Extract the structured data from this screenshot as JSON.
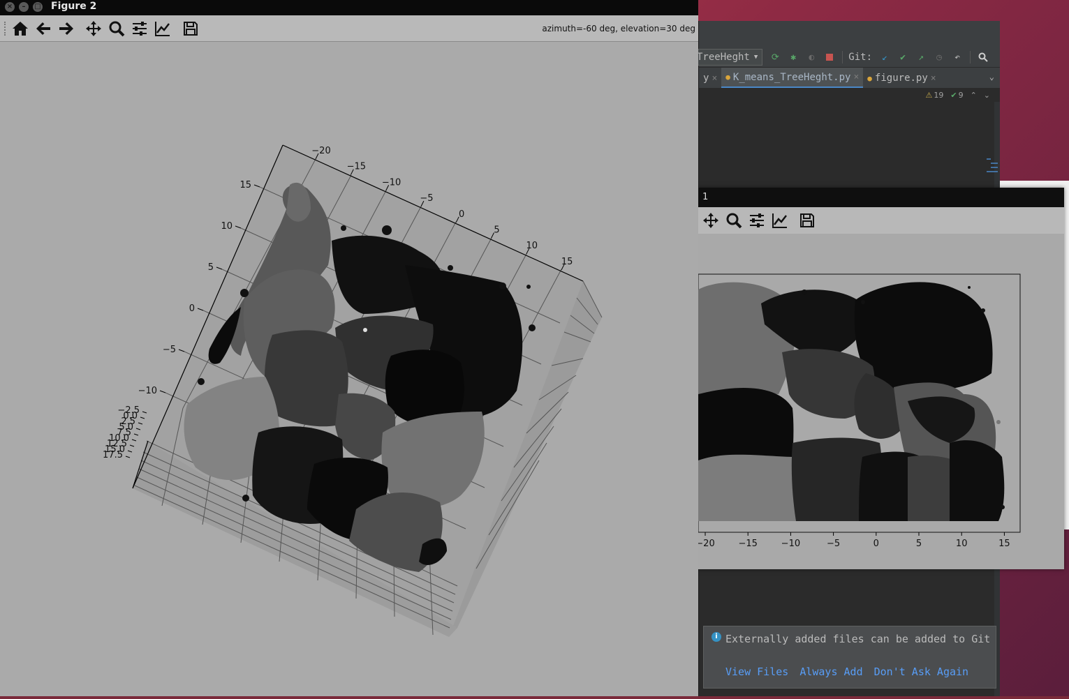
{
  "figure2": {
    "title": "Figure 2",
    "toolbar": {
      "home": "home-icon",
      "back": "arrow-left-icon",
      "forward": "arrow-right-icon",
      "pan": "move-icon",
      "zoom": "magnifier-icon",
      "subplots": "sliders-icon",
      "axes": "line-chart-icon",
      "save": "save-icon"
    },
    "status": "azimuth=-60 deg, elevation=30 deg"
  },
  "ide": {
    "run_config": "TreeHeght",
    "git_label": "Git:",
    "tabs": [
      {
        "label": "y",
        "active": false
      },
      {
        "label": "K_means_TreeHeght.py",
        "active": true
      },
      {
        "label": "figure.py",
        "active": false
      }
    ],
    "warnings": "19",
    "checks": "9"
  },
  "figure1": {
    "title_partial": "1"
  },
  "notification": {
    "message": "Externally added files can be added to Git",
    "actions": [
      "View Files",
      "Always Add",
      "Don't Ask Again"
    ]
  },
  "chart_data": [
    {
      "type": "scatter",
      "title": "",
      "view": "3d",
      "x_ticks": [
        "−20",
        "−15",
        "−10",
        "−5",
        "0",
        "5",
        "10",
        "15"
      ],
      "y_ticks": [
        "15",
        "10",
        "5",
        "0",
        "−5",
        "−10"
      ],
      "z_ticks": [
        "−2.5",
        "0.0",
        "2.5",
        "5.0",
        "7.5",
        "10.0",
        "12.5",
        "15.0",
        "17.5"
      ],
      "clusters": 14,
      "colors": [
        "#101010",
        "#1c1c1c",
        "#2a2a2a",
        "#3a3a3a",
        "#4a4a4a",
        "#5a5a5a",
        "#6a6a6a",
        "#7a7a7a"
      ]
    },
    {
      "type": "scatter",
      "title": "",
      "view": "2d",
      "x_ticks": [
        "−20",
        "−15",
        "−10",
        "−5",
        "0",
        "5",
        "10",
        "15"
      ],
      "xlim": [
        -20,
        17
      ]
    }
  ]
}
